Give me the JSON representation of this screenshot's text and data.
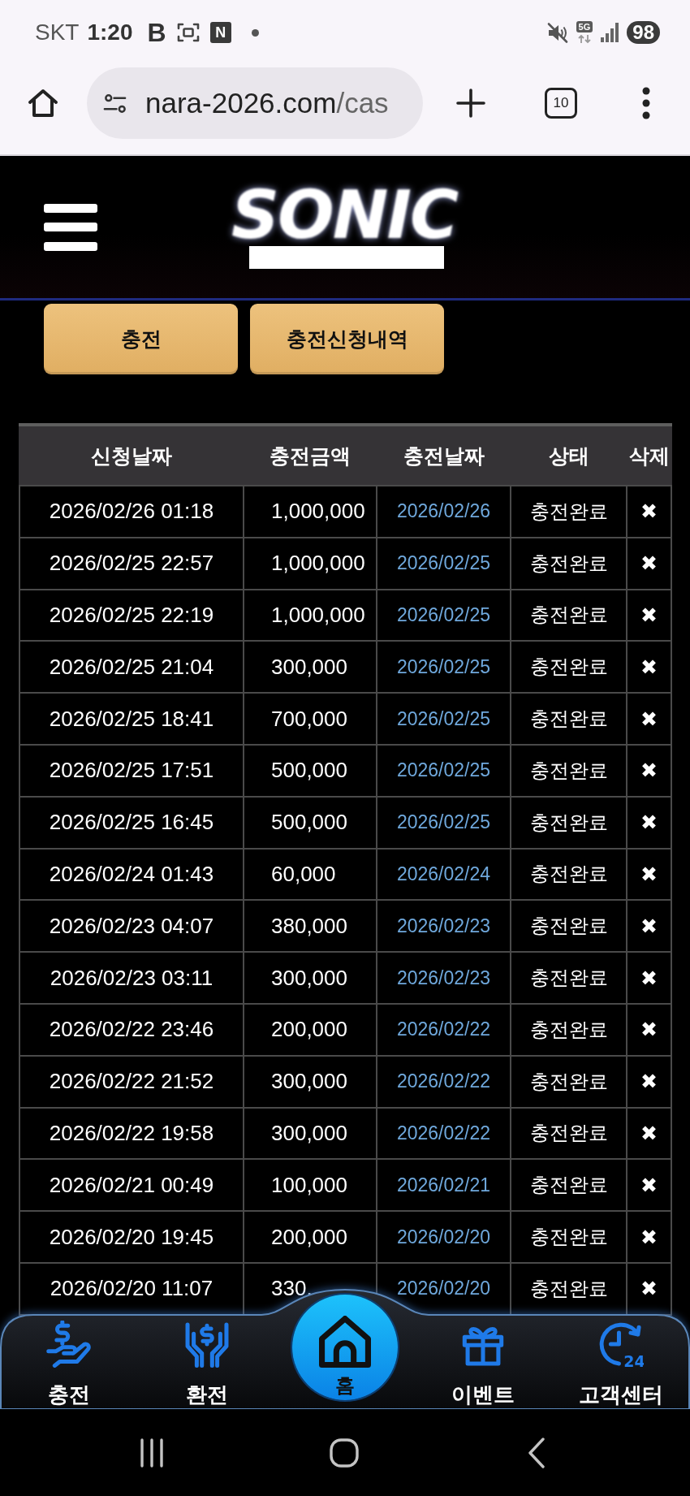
{
  "status_bar": {
    "carrier": "SKT",
    "time": "1:20",
    "notifications": [
      {
        "kind": "letter",
        "text": "B"
      },
      {
        "kind": "screenshot"
      },
      {
        "kind": "boxed-letter",
        "text": "N"
      },
      {
        "kind": "dot"
      }
    ],
    "network": "5G",
    "battery": "98"
  },
  "browser": {
    "url_host": "nara-2026.com",
    "url_path": "/cas",
    "tab_count": "10"
  },
  "header": {
    "logo": "SONIC"
  },
  "actions": [
    {
      "label": "충전"
    },
    {
      "label": "충전신청내역"
    }
  ],
  "table": {
    "columns": [
      "신청날짜",
      "충전금액",
      "충전날짜",
      "상태",
      "삭제"
    ],
    "rows": [
      {
        "requested": "2026/02/26 01:18",
        "amount": "1,000,000",
        "charged": "2026/02/26",
        "status": "충전완료",
        "delete": "✖"
      },
      {
        "requested": "2026/02/25 22:57",
        "amount": "1,000,000",
        "charged": "2026/02/25",
        "status": "충전완료",
        "delete": "✖"
      },
      {
        "requested": "2026/02/25 22:19",
        "amount": "1,000,000",
        "charged": "2026/02/25",
        "status": "충전완료",
        "delete": "✖"
      },
      {
        "requested": "2026/02/25 21:04",
        "amount": "300,000",
        "charged": "2026/02/25",
        "status": "충전완료",
        "delete": "✖"
      },
      {
        "requested": "2026/02/25 18:41",
        "amount": "700,000",
        "charged": "2026/02/25",
        "status": "충전완료",
        "delete": "✖"
      },
      {
        "requested": "2026/02/25 17:51",
        "amount": "500,000",
        "charged": "2026/02/25",
        "status": "충전완료",
        "delete": "✖"
      },
      {
        "requested": "2026/02/25 16:45",
        "amount": "500,000",
        "charged": "2026/02/25",
        "status": "충전완료",
        "delete": "✖"
      },
      {
        "requested": "2026/02/24 01:43",
        "amount": "60,000",
        "charged": "2026/02/24",
        "status": "충전완료",
        "delete": "✖"
      },
      {
        "requested": "2026/02/23 04:07",
        "amount": "380,000",
        "charged": "2026/02/23",
        "status": "충전완료",
        "delete": "✖"
      },
      {
        "requested": "2026/02/23 03:11",
        "amount": "300,000",
        "charged": "2026/02/23",
        "status": "충전완료",
        "delete": "✖"
      },
      {
        "requested": "2026/02/22 23:46",
        "amount": "200,000",
        "charged": "2026/02/22",
        "status": "충전완료",
        "delete": "✖"
      },
      {
        "requested": "2026/02/22 21:52",
        "amount": "300,000",
        "charged": "2026/02/22",
        "status": "충전완료",
        "delete": "✖"
      },
      {
        "requested": "2026/02/22 19:58",
        "amount": "300,000",
        "charged": "2026/02/22",
        "status": "충전완료",
        "delete": "✖"
      },
      {
        "requested": "2026/02/21 00:49",
        "amount": "100,000",
        "charged": "2026/02/21",
        "status": "충전완료",
        "delete": "✖"
      },
      {
        "requested": "2026/02/20 19:45",
        "amount": "200,000",
        "charged": "2026/02/20",
        "status": "충전완료",
        "delete": "✖"
      },
      {
        "requested": "2026/02/20 11:07",
        "amount": "330,",
        "charged": "2026/02/20",
        "status": "충전완료",
        "delete": "✖"
      }
    ]
  },
  "bottom_nav": [
    {
      "kind": "charge",
      "label": "충전"
    },
    {
      "kind": "exchange",
      "label": "환전"
    },
    {
      "kind": "home",
      "label": "홈"
    },
    {
      "kind": "event",
      "label": "이벤트"
    },
    {
      "kind": "support",
      "label": "고객센터",
      "icon_text": "24"
    }
  ]
}
